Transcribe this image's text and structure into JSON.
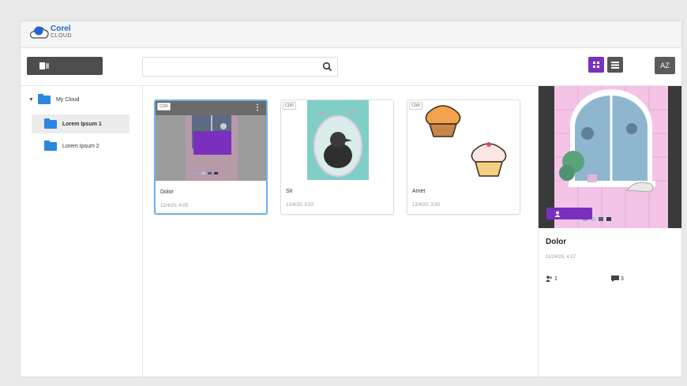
{
  "app": {
    "brand": "Corel",
    "brand_tm": "®",
    "sub": "CLOUD"
  },
  "toolbar": {
    "upload_label": "",
    "search_placeholder": "",
    "sort_label": "AZ"
  },
  "sidebar": {
    "root": "My Cloud",
    "items": [
      {
        "label": "Lorem Ipsum 1",
        "selected": true
      },
      {
        "label": "Lorem Ipsum 2",
        "selected": false
      }
    ]
  },
  "files": [
    {
      "badge": "CDR",
      "name": "Dolor",
      "date": "12/4/20, 4:05",
      "selected": true
    },
    {
      "badge": "CDR",
      "name": "Sit",
      "date": "12/4/20, 3:52",
      "selected": false
    },
    {
      "badge": "CDR",
      "name": "Amet",
      "date": "12/4/20, 3:50",
      "selected": false
    }
  ],
  "details": {
    "name": "Dolor",
    "date": "11/24/20, 4:27",
    "users_count": "1",
    "comments_count": "3"
  },
  "colors": {
    "accent": "#7a2fbe",
    "folder": "#2d86e0",
    "selection": "#6cb3ee"
  }
}
